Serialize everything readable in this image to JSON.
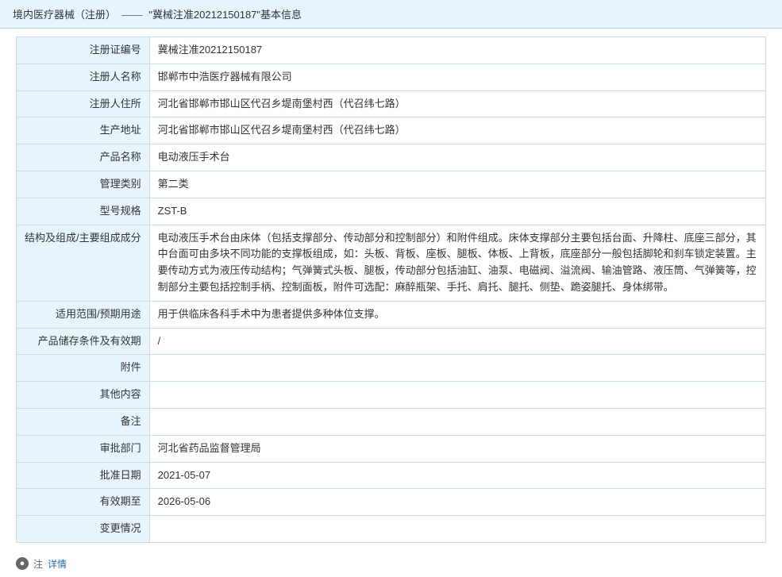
{
  "header": {
    "breadcrumb_part1": "境内医疗器械（注册）",
    "breadcrumb_sep": "——",
    "breadcrumb_part2": "\"冀械注准20212150187\"基本信息"
  },
  "table": {
    "rows": [
      {
        "label": "注册证编号",
        "value": "冀械注准20212150187"
      },
      {
        "label": "注册人名称",
        "value": "邯郸市中浩医疗器械有限公司"
      },
      {
        "label": "注册人住所",
        "value": "河北省邯郸市邯山区代召乡堤南堡村西（代召纬七路）"
      },
      {
        "label": "生产地址",
        "value": "河北省邯郸市邯山区代召乡堤南堡村西（代召纬七路）"
      },
      {
        "label": "产品名称",
        "value": "电动液压手术台"
      },
      {
        "label": "管理类别",
        "value": "第二类"
      },
      {
        "label": "型号规格",
        "value": "ZST-B"
      },
      {
        "label": "结构及组成/主要组成成分",
        "value": "电动液压手术台由床体（包括支撑部分、传动部分和控制部分）和附件组成。床体支撑部分主要包括台面、升降柱、底座三部分，其中台面可由多块不同功能的支撑板组成，如：头板、背板、座板、腿板、体板、上背板，底座部分一般包括脚轮和刹车锁定装置。主要传动方式为液压传动结构；气弹簧式头板、腿板，传动部分包括油缸、油泵、电磁阀、溢流阀、输油管路、液压筒、气弹簧等，控制部分主要包括控制手柄、控制面板，附件可选配：麻醉瓶架、手托、肩托、腿托、侧垫、跪姿腿托、身体绑带。"
      },
      {
        "label": "适用范围/预期用途",
        "value": "用于供临床各科手术中为患者提供多种体位支撑。"
      },
      {
        "label": "产品储存条件及有效期",
        "value": "/"
      },
      {
        "label": "附件",
        "value": ""
      },
      {
        "label": "其他内容",
        "value": ""
      },
      {
        "label": "备注",
        "value": ""
      },
      {
        "label": "审批部门",
        "value": "河北省药品监督管理局"
      },
      {
        "label": "批准日期",
        "value": "2021-05-07"
      },
      {
        "label": "有效期至",
        "value": "2026-05-06"
      },
      {
        "label": "变更情况",
        "value": ""
      }
    ]
  },
  "footer": {
    "note_symbol": "●",
    "note_label": "注",
    "link_text": "详情"
  }
}
